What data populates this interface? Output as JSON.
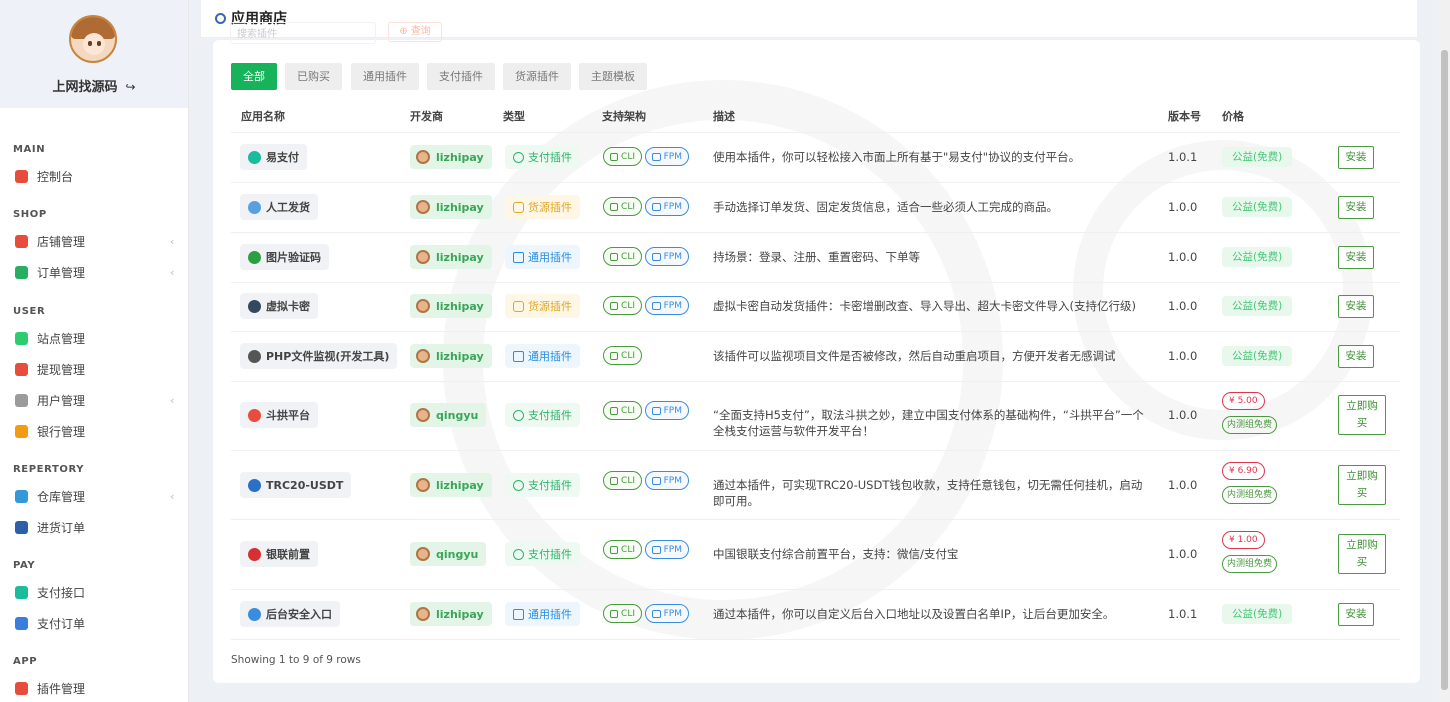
{
  "sidebar": {
    "username": "上网找源码",
    "logout_icon": "logout-icon",
    "groups": [
      {
        "label": "MAIN",
        "items": [
          {
            "label": "控制台",
            "icon": "home-icon",
            "color": "#e74c3c"
          }
        ]
      },
      {
        "label": "SHOP",
        "items": [
          {
            "label": "店铺管理",
            "icon": "store-icon",
            "color": "#e74c3c"
          },
          {
            "label": "订单管理",
            "icon": "order-edit-icon",
            "color": "#27ae60"
          }
        ]
      },
      {
        "label": "USER",
        "items": [
          {
            "label": "站点管理",
            "icon": "site-icon",
            "color": "#2ecc71"
          },
          {
            "label": "提现管理",
            "icon": "withdraw-icon",
            "color": "#e74c3c"
          },
          {
            "label": "用户管理",
            "icon": "users-icon",
            "color": "#9b9b9b"
          },
          {
            "label": "银行管理",
            "icon": "bank-icon",
            "color": "#f39c12"
          }
        ]
      },
      {
        "label": "REPERTORY",
        "items": [
          {
            "label": "仓库管理",
            "icon": "warehouse-icon",
            "color": "#3498db"
          },
          {
            "label": "进货订单",
            "icon": "purchase-order-icon",
            "color": "#2c5fa8"
          }
        ]
      },
      {
        "label": "PAY",
        "items": [
          {
            "label": "支付接口",
            "icon": "payment-api-icon",
            "color": "#1abc9c"
          },
          {
            "label": "支付订单",
            "icon": "payment-order-icon",
            "color": "#3b7ddd"
          }
        ]
      },
      {
        "label": "APP",
        "items": [
          {
            "label": "插件管理",
            "icon": "plugin-icon",
            "color": "#e74c3c"
          }
        ]
      }
    ]
  },
  "header": {
    "title": "应用商店",
    "search_placeholder": "搜索插件",
    "search_button": "查询"
  },
  "tabs": [
    "全部",
    "已购买",
    "通用插件",
    "支付插件",
    "货源插件",
    "主题模板"
  ],
  "table": {
    "columns": [
      "应用名称",
      "开发商",
      "类型",
      "支持架构",
      "描述",
      "版本号",
      "价格"
    ],
    "rows": [
      {
        "name": "易支付",
        "icon_color": "#1abc9c",
        "developer": "lizhipay",
        "type": "支付插件",
        "type_class": "pay",
        "archs": [
          "CLI",
          "FPM"
        ],
        "description": "使用本插件，你可以轻松接入市面上所有基于\"易支付\"协议的支付平台。",
        "version": "1.0.1",
        "price": "公益(免费)",
        "paid": false,
        "action": "安装"
      },
      {
        "name": "人工发货",
        "icon_color": "#5aa0e0",
        "developer": "lizhipay",
        "type": "货源插件",
        "type_class": "src",
        "archs": [
          "CLI",
          "FPM"
        ],
        "description": "手动选择订单发货、固定发货信息，适合一些必须人工完成的商品。",
        "version": "1.0.0",
        "price": "公益(免费)",
        "paid": false,
        "action": "安装"
      },
      {
        "name": "图片验证码",
        "icon_color": "#2c9f45",
        "developer": "lizhipay",
        "type": "通用插件",
        "type_class": "gen",
        "archs": [
          "CLI",
          "FPM"
        ],
        "description": "持场景：登录、注册、重置密码、下单等",
        "version": "1.0.0",
        "price": "公益(免费)",
        "paid": false,
        "action": "安装"
      },
      {
        "name": "虚拟卡密",
        "icon_color": "#34495e",
        "developer": "lizhipay",
        "type": "货源插件",
        "type_class": "src",
        "archs": [
          "CLI",
          "FPM"
        ],
        "description": "虚拟卡密自动发货插件：卡密增删改查、导入导出、超大卡密文件导入(支持亿行级)",
        "version": "1.0.0",
        "price": "公益(免费)",
        "paid": false,
        "action": "安装"
      },
      {
        "name": "PHP文件监视(开发工具)",
        "icon_color": "#555555",
        "developer": "lizhipay",
        "type": "通用插件",
        "type_class": "gen",
        "archs": [
          "CLI"
        ],
        "description": "该插件可以监视项目文件是否被修改，然后自动重启项目，方便开发者无感调试",
        "version": "1.0.0",
        "price": "公益(免费)",
        "paid": false,
        "action": "安装"
      },
      {
        "name": "斗拱平台",
        "icon_color": "#e74c3c",
        "developer": "qingyu",
        "type": "支付插件",
        "type_class": "pay",
        "archs": [
          "CLI",
          "FPM"
        ],
        "description": "“全面支持H5支付”，取法斗拱之妙，建立中国支付体系的基础构件，“斗拱平台”一个全栈支付运营与软件开发平台！",
        "version": "1.0.0",
        "price": "¥ 5.00",
        "free_note": "内测组免费",
        "paid": true,
        "action": "立即购买"
      },
      {
        "name": "TRC20-USDT",
        "icon_color": "#2c6fc7",
        "developer": "lizhipay",
        "type": "支付插件",
        "type_class": "pay",
        "archs": [
          "CLI",
          "FPM"
        ],
        "description": "通过本插件，可实现TRC20-USDT钱包收款，支持任意钱包，切无需任何挂机，启动即可用。",
        "version": "1.0.0",
        "price": "¥ 6.90",
        "free_note": "内测组免费",
        "paid": true,
        "action": "立即购买"
      },
      {
        "name": "银联前置",
        "icon_color": "#d63031",
        "developer": "qingyu",
        "type": "支付插件",
        "type_class": "pay",
        "archs": [
          "CLI",
          "FPM"
        ],
        "description": "中国银联支付综合前置平台，支持：微信/支付宝",
        "version": "1.0.0",
        "price": "¥ 1.00",
        "free_note": "内测组免费",
        "paid": true,
        "action": "立即购买"
      },
      {
        "name": "后台安全入口",
        "icon_color": "#3a8ce0",
        "developer": "lizhipay",
        "type": "通用插件",
        "type_class": "gen",
        "archs": [
          "CLI",
          "FPM"
        ],
        "description": "通过本插件，你可以自定义后台入口地址以及设置白名单IP，让后台更加安全。",
        "version": "1.0.1",
        "price": "公益(免费)",
        "paid": false,
        "action": "安装"
      }
    ]
  },
  "footer": {
    "showing": "Showing 1 to 9 of 9 rows"
  }
}
